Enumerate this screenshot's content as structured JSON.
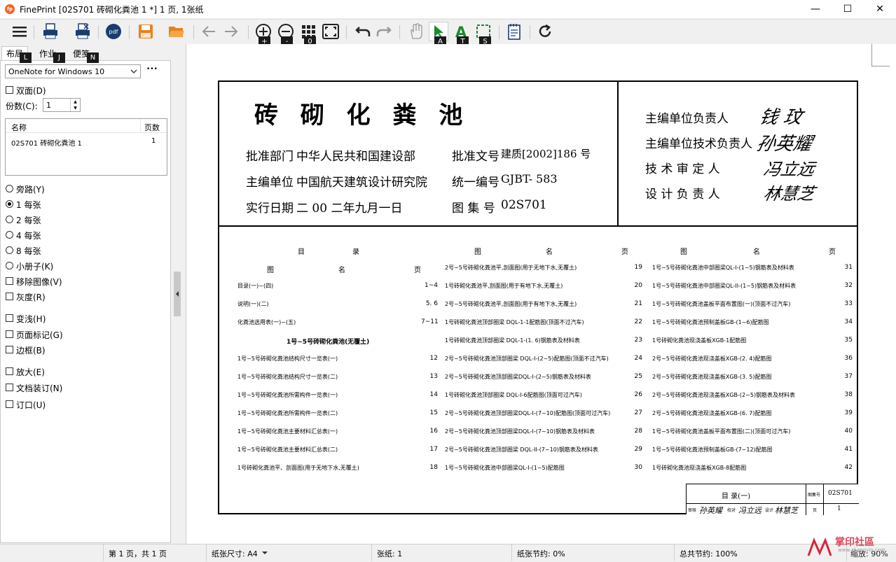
{
  "window": {
    "title": "FinePrint [02S701 砖砌化粪池 1 *] 1 页, 1张纸",
    "minimize": "—",
    "maximize": "☐",
    "close": "✕"
  },
  "toolbar": {
    "badges": {
      "zoom_in": "+",
      "zoom_out": "-",
      "thumbs": "0",
      "select": "A",
      "text": "T",
      "crop": "S"
    },
    "tab_badges": {
      "layout": "L",
      "job": "J",
      "notes": "N"
    }
  },
  "tabs": {
    "layout": "布局",
    "job": "作业",
    "notes": "便笺"
  },
  "printer": {
    "selected": "OneNote for Windows 10",
    "more": "•••"
  },
  "options": {
    "duplex": "双面(D)",
    "copies_label": "份数(C):",
    "copies_value": "1"
  },
  "joblist": {
    "col_name": "名称",
    "col_pages": "页数",
    "rows": [
      {
        "name": "02S701 砖砌化粪池 1",
        "pages": "1"
      }
    ]
  },
  "layout_opts": {
    "bypass": "旁路(Y)",
    "one": "1 每张",
    "two": "2 每张",
    "four": "4 每张",
    "eight": "8 每张",
    "booklet": "小册子(K)"
  },
  "checks": {
    "remove_images": "移除图像(V)",
    "grayscale": "灰度(R)",
    "transform": "变浅(H)",
    "page_marks": "页面标记(G)",
    "border": "边框(B)",
    "enlarge": "放大(E)",
    "binding": "文档装订(N)",
    "gutter": "订口(U)"
  },
  "status": {
    "page": "第 1 页，共 1 页",
    "paper": "纸张尺寸: A4",
    "sheets": "张纸:  1",
    "saved": "纸张节约:  0%",
    "total": "总共节约:  100%",
    "zoom": "缩放:  90%",
    "watermark": "掌印社區",
    "watermark_url": "www.zhangyin.com"
  },
  "doc": {
    "title": "砖 砌 化 粪 池",
    "dept_l": "批准部门",
    "dept_v": "中华人民共和国建设部",
    "edit_l": "主编单位",
    "edit_v": "中国航天建筑设计研究院",
    "date_l": "实行日期",
    "date_v": "二 00 二年九月一日",
    "doc_l": "批准文号",
    "doc_v": "建质[2002]186 号",
    "uid_l": "统一编号",
    "uid_v": "GJBT- 583",
    "set_l": "图 集 号",
    "set_v": "02S701",
    "r1": "主编单位负责人",
    "r2": "主编单位技术负责人",
    "r3": "技 术 审 定 人",
    "r4": "设 计 负 责 人",
    "s1": "钱 玟",
    "s2": "孙英耀",
    "s3": "冯立远",
    "s4": "林慧芝",
    "h_mu": "目",
    "h_lu": "录",
    "h_tu": "图",
    "h_ming": "名",
    "h_ye": "页",
    "col1": [
      [
        "目录(一)~(四)",
        "1~4"
      ],
      [
        "说明(一)(二)",
        "5. 6"
      ],
      [
        "化粪池选用表(一)~(五)",
        "7~11"
      ],
      [
        "1号~5号砖砌化粪池(无覆土)",
        ""
      ],
      [
        "1号~5号砖砌化粪池结构尺寸一览表(一)",
        "12"
      ],
      [
        "1号~5号砖砌化粪池结构尺寸一览表(二)",
        "13"
      ],
      [
        "1号~5号砖砌化粪池所需构件一览表(一)",
        "14"
      ],
      [
        "1号~5号砖砌化粪池所需构件一览表(二)",
        "15"
      ],
      [
        "1号~5号砖砌化粪池主要材料汇总表(一)",
        "16"
      ],
      [
        "1号~5号砖砌化粪池主要材料汇总表(二)",
        "17"
      ],
      [
        "1号砖砌化粪池平、剖面图(用于无地下水,无覆土)",
        "18"
      ]
    ],
    "col2": [
      [
        "2号~5号砖砌化粪池平,剖面图(用于无地下水,无覆土)",
        "19"
      ],
      [
        "1号砖砌化粪池平,剖面图(用于有地下水,无覆土)",
        "20"
      ],
      [
        "2号~5号砖砌化粪池平,剖面图(用于有地下水,无覆土)",
        "21"
      ],
      [
        "1号砖砌化粪池顶部圈梁 DQL-1-1配筋图(顶面不过汽车)",
        "22"
      ],
      [
        "1号砖砌化粪池顶部圈梁 DQL-1-(1. 6)钢筋表及材料表",
        "23"
      ],
      [
        "2号~5号砖砌化粪池顶部圈梁 DQL-I-(2~5)配筋图(顶面不过汽车)",
        "24"
      ],
      [
        "2号~5号砖砌化粪池顶部圈梁DQL-I-(2~5)钢筋表及材料表",
        "25"
      ],
      [
        "1号砖砌化粪池顶部圈梁 DQL-I-6配筋图(顶面可过汽车)",
        "26"
      ],
      [
        "2号~5号砖砌化粪池顶部圈梁DQL-I-(7~10)配筋图(顶面可过汽车)",
        "27"
      ],
      [
        "2号~5号砖砌化粪池顶部圈梁DQL-I-(7~10)钢筋表及材料表",
        "28"
      ],
      [
        "2号~5号砖砌化粪池顶部圈梁 DQL-II-(7~10)钢筋表及材料表",
        "29"
      ],
      [
        "1号~5号砖砌化粪池中部圈梁QL-I-(1~5)配筋图",
        "30"
      ]
    ],
    "col3": [
      [
        "1号~5号砖砌化粪池中部圈梁QL-I-(1~5)钢筋表及材料表",
        "31"
      ],
      [
        "1号~5号砖砌化粪池中部圈梁QL-II-(1~5)钢筋表及材料表",
        "32"
      ],
      [
        "1号~5号砖砌化粪池盖板平面布置图(一)(顶面不过汽车)",
        "33"
      ],
      [
        "1号~5号砖砌化粪池预制盖板GB-(1~6)配筋图",
        "34"
      ],
      [
        "1号砖砌化粪池现浇盖板XGB-1配筋图",
        "35"
      ],
      [
        "2号~5号砖砌化粪池现浇盖板XGB-(2. 4)配筋图",
        "36"
      ],
      [
        "2号~5号砖砌化粪池现浇盖板XGB-(3. 5)配筋图",
        "37"
      ],
      [
        "2号~5号砖砌化粪池现浇盖板XGB-(2~5)钢筋表及材料表",
        "38"
      ],
      [
        "2号~5号砖砌化粪池现浇盖板XGB-(6. 7)配筋图",
        "39"
      ],
      [
        "1号~5号砖砌化粪池盖板平面布置图(二)(顶面可过汽车)",
        "40"
      ],
      [
        "1号~5号砖砌化粪池预制盖板GB-(7~12)配筋图",
        "41"
      ],
      [
        "1号砖砌化粪池现浇盖板XGB-8配筋图",
        "42"
      ]
    ],
    "tb_title": "目    录(一)",
    "tb_setl": "图集号",
    "tb_setv": "02S701",
    "tb_review": "审核",
    "tb_check": "校对",
    "tb_design": "设计",
    "tb_page": "页",
    "tb_pagev": "1"
  }
}
